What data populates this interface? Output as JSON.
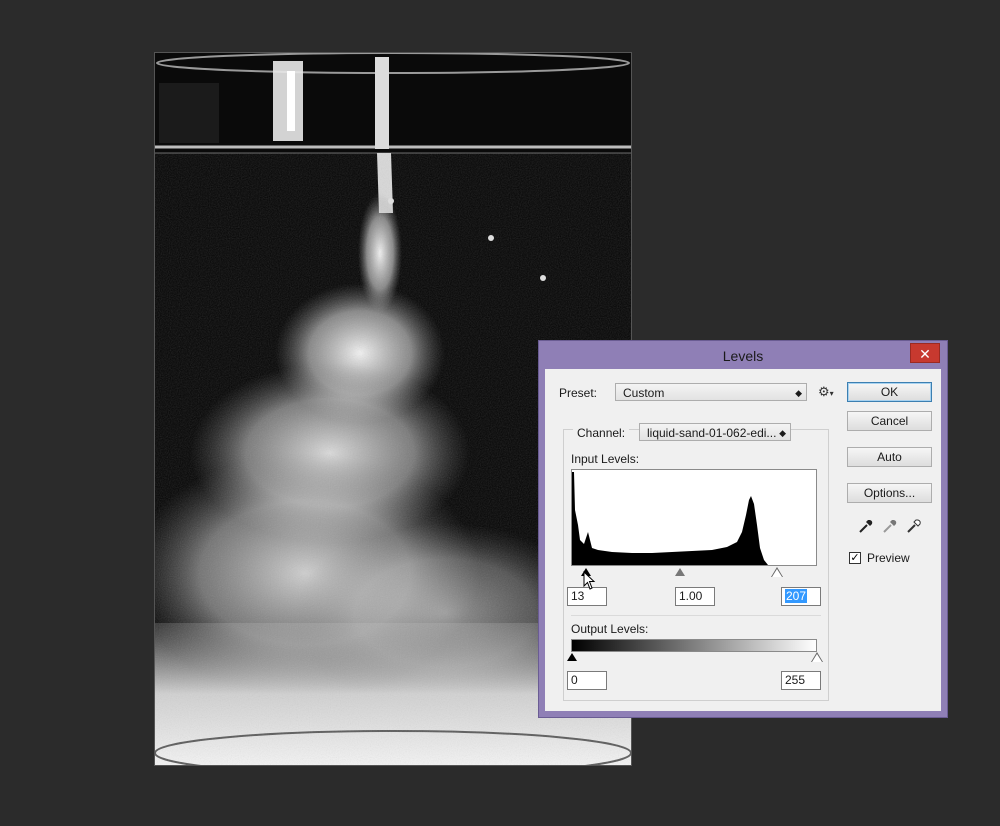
{
  "dialog": {
    "title": "Levels",
    "close": "✕",
    "preset_label": "Preset:",
    "preset_value": "Custom",
    "channel_label": "Channel:",
    "channel_value": "liquid-sand-01-062-edi...",
    "input_levels_label": "Input Levels:",
    "input_black": "13",
    "input_gamma": "1.00",
    "input_white": "207",
    "output_levels_label": "Output Levels:",
    "output_black": "0",
    "output_white": "255",
    "buttons": {
      "ok": "OK",
      "cancel": "Cancel",
      "auto": "Auto",
      "options": "Options..."
    },
    "preview_label": "Preview",
    "preview_checked": true
  },
  "icons": {
    "gear": "gear-icon",
    "eyedroppers": [
      "black-eyedropper-icon",
      "gray-eyedropper-icon",
      "white-eyedropper-icon"
    ]
  },
  "colors": {
    "titlebar": "#8f7fb6",
    "close": "#c7392f",
    "workspace": "#2b2b2b"
  }
}
